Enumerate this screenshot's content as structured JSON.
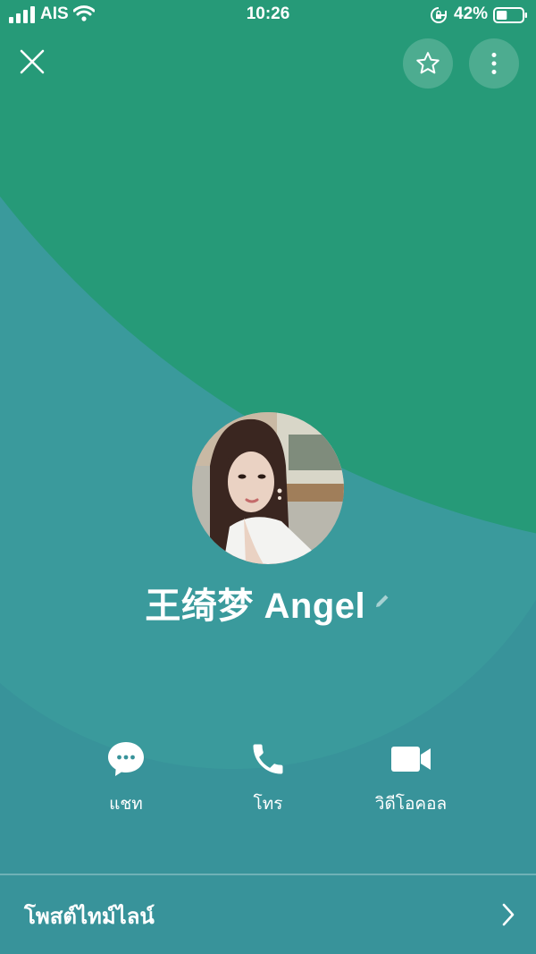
{
  "status_bar": {
    "carrier": "AIS",
    "time": "10:26",
    "battery_percent": "42%",
    "battery_level": 0.42
  },
  "profile": {
    "display_name": "王绮梦 Angel"
  },
  "actions": [
    {
      "label": "แชท",
      "icon": "chat-bubble-icon"
    },
    {
      "label": "โทร",
      "icon": "phone-icon"
    },
    {
      "label": "วิดีโอคอล",
      "icon": "video-camera-icon"
    }
  ],
  "timeline": {
    "label": "โพสต์ไทม์ไลน์"
  },
  "colors": {
    "top_green": "#269a78",
    "middle_teal": "#3a9a9c",
    "base_teal": "#38939a"
  }
}
